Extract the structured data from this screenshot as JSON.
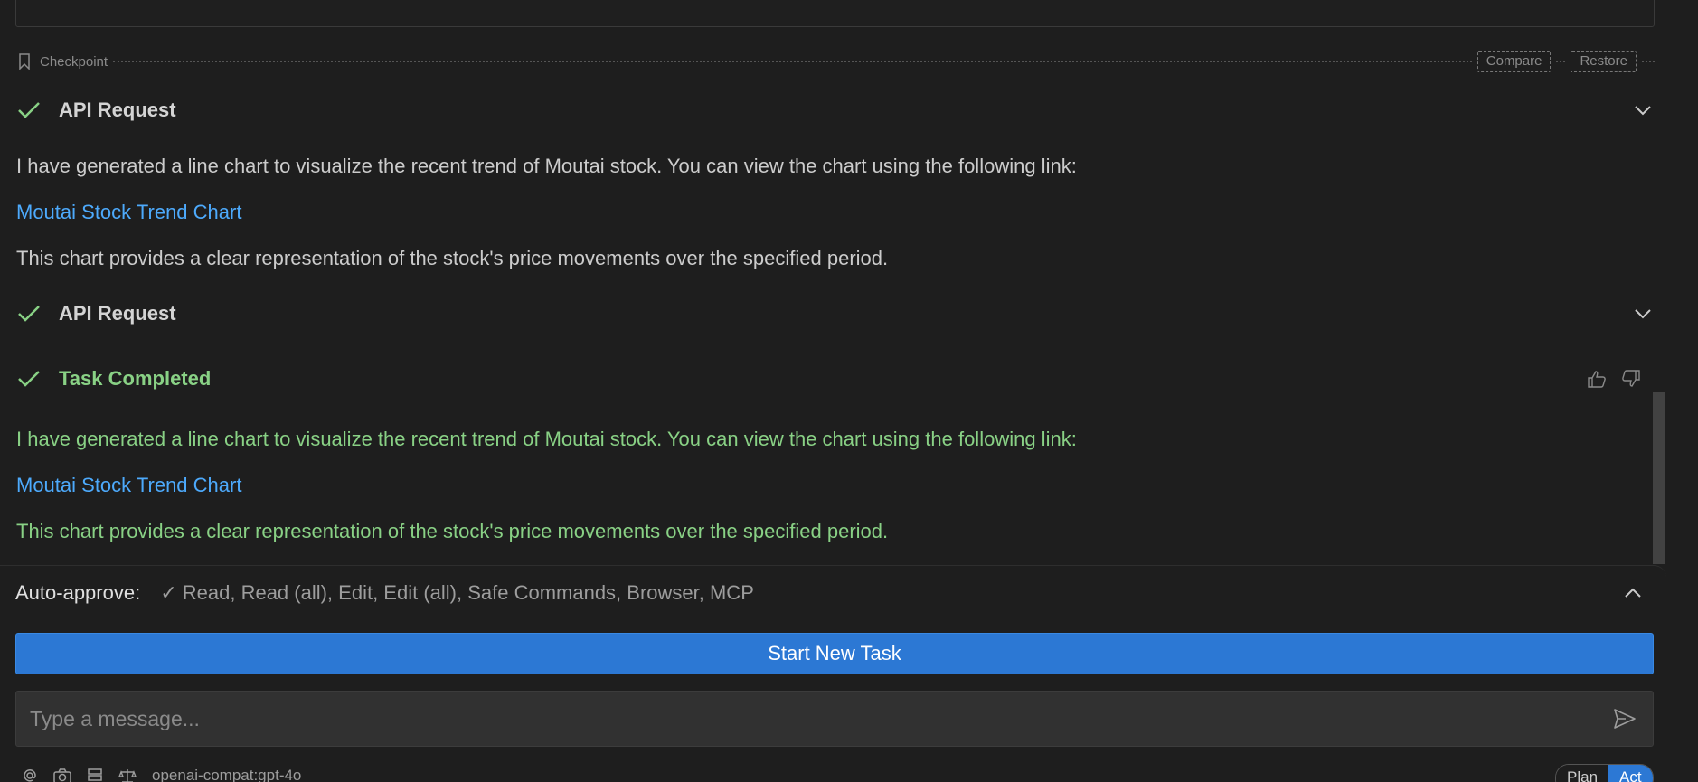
{
  "checkpoint": {
    "label": "Checkpoint",
    "compare_label": "Compare",
    "restore_label": "Restore"
  },
  "messages": [
    {
      "type": "api_request",
      "title": "API Request",
      "text": "I have generated a line chart to visualize the recent trend of Moutai stock. You can view the chart using the following link:",
      "link_text": "Moutai Stock Trend Chart",
      "footer": "This chart provides a clear representation of the stock's price movements over the specified period."
    },
    {
      "type": "api_request",
      "title": "API Request"
    },
    {
      "type": "task_completed",
      "title": "Task Completed",
      "text": "I have generated a line chart to visualize the recent trend of Moutai stock. You can view the chart using the following link:",
      "link_text": "Moutai Stock Trend Chart",
      "footer": "This chart provides a clear representation of the stock's price movements over the specified period."
    }
  ],
  "auto_approve": {
    "label": "Auto-approve:",
    "value": "✓ Read, Read (all), Edit, Edit (all), Safe Commands, Browser, MCP"
  },
  "start_new_task_label": "Start New Task",
  "message_input": {
    "placeholder": "Type a message...",
    "value": ""
  },
  "toolbar": {
    "model": "openai-compat:gpt-4o"
  },
  "mode_toggle": {
    "plan_label": "Plan",
    "act_label": "Act",
    "active": "Act"
  },
  "colors": {
    "background": "#1e1e1e",
    "success_green": "#89d185",
    "link_blue": "#4daafc",
    "primary_button": "#2c78d4"
  },
  "icons": {
    "checkpoint": "bookmark-icon",
    "status": "check-icon",
    "expand": "chevron-down-icon",
    "collapse": "chevron-up-icon",
    "feedback_positive": "thumbs-up-icon",
    "feedback_negative": "thumbs-down-icon",
    "send": "send-icon"
  }
}
